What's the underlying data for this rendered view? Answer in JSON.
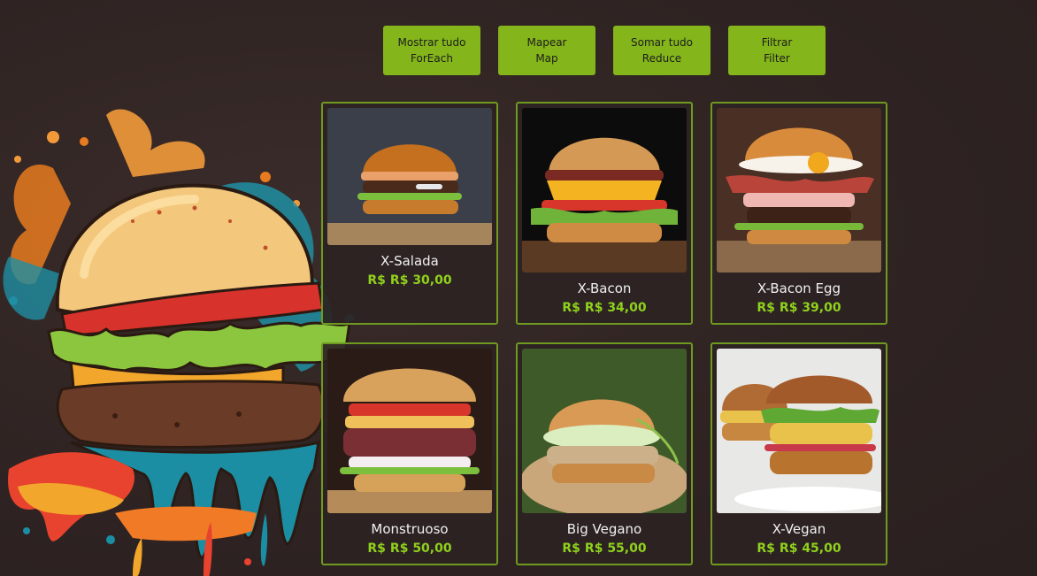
{
  "buttons": [
    {
      "line1": "Mostrar tudo",
      "line2": "ForEach"
    },
    {
      "line1": "Mapear",
      "line2": "Map"
    },
    {
      "line1": "Somar tudo",
      "line2": "Reduce"
    },
    {
      "line1": "Filtrar",
      "line2": "Filter"
    }
  ],
  "products": [
    {
      "name": "X-Salada",
      "currency": "R$",
      "price": "R$ 30,00"
    },
    {
      "name": "X-Bacon",
      "currency": "R$",
      "price": "R$ 34,00"
    },
    {
      "name": "X-Bacon Egg",
      "currency": "R$",
      "price": "R$ 39,00"
    },
    {
      "name": "Monstruoso",
      "currency": "R$",
      "price": "R$ 50,00"
    },
    {
      "name": "Big Vegano",
      "currency": "R$",
      "price": "R$ 55,00"
    },
    {
      "name": "X-Vegan",
      "currency": "R$",
      "price": "R$ 45,00"
    }
  ],
  "colors": {
    "background": "#2f2424",
    "accent": "#84b51a",
    "price": "#8fd11c",
    "card_border": "#6f9a20"
  }
}
